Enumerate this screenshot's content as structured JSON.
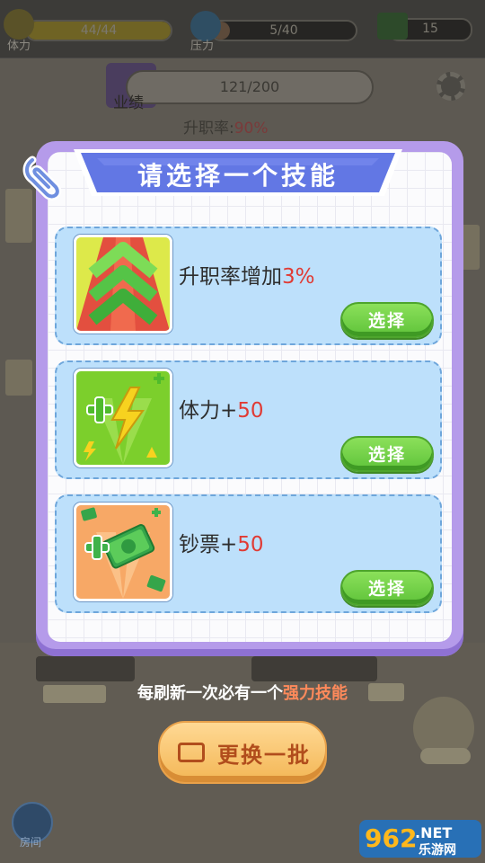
{
  "topbar": {
    "stamina_label": "体力",
    "stamina_value": "44/44",
    "stamina_fill": 1.0,
    "pressure_label": "压力",
    "pressure_value": "5/40",
    "pressure_fill": 0.125,
    "cash_value": "15"
  },
  "performance": {
    "label": "业绩",
    "progress": "121/200",
    "promotion_label": "升职率:",
    "promotion_value": "90%"
  },
  "modal": {
    "title": "请选择一个技能",
    "skills": [
      {
        "name": "升职率增加",
        "value": "3%",
        "button": "选择",
        "icon": "promotion-arrows-icon"
      },
      {
        "name": "体力+",
        "value": "50",
        "button": "选择",
        "icon": "stamina-lightning-icon"
      },
      {
        "name": "钞票+",
        "value": "50",
        "button": "选择",
        "icon": "cash-bundle-icon"
      }
    ]
  },
  "hint": {
    "prefix": "每刷新一次必有一个",
    "highlight": "强力技能"
  },
  "refresh_button": "更换一批",
  "home_label": "房间",
  "watermark": {
    "brand": "962",
    "suffix": ".NET",
    "site": "乐游网"
  },
  "colors": {
    "accent_purple": "#b59bea",
    "card_blue": "#bde0fb",
    "button_green": "#6ccb45",
    "highlight_red": "#e03b34",
    "refresh_orange": "#f3b655"
  }
}
